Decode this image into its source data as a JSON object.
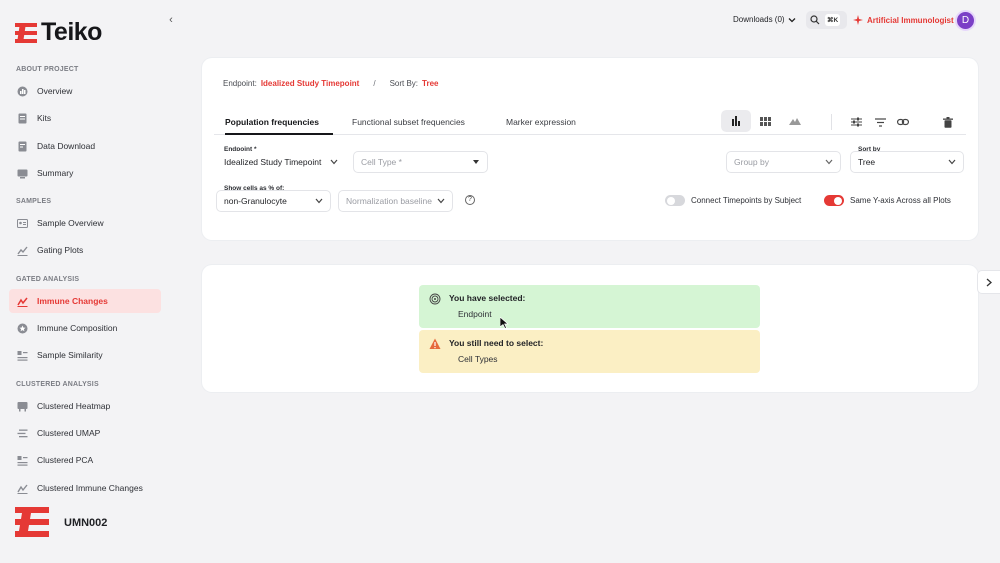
{
  "app": {
    "name": "Teiko",
    "project_code": "UMN002",
    "accent": "#e53935"
  },
  "sidebar": {
    "sections": [
      {
        "label": "ABOUT PROJECT"
      },
      {
        "label": "SAMPLES"
      },
      {
        "label": "GATED ANALYSIS"
      },
      {
        "label": "CLUSTERED ANALYSIS"
      }
    ],
    "items": [
      {
        "label": "Overview",
        "icon": "bar-chart-icon"
      },
      {
        "label": "Kits",
        "icon": "document-icon"
      },
      {
        "label": "Data Download",
        "icon": "download-document-icon"
      },
      {
        "label": "Summary",
        "icon": "monitor-icon"
      },
      {
        "label": "Sample Overview",
        "icon": "id-card-icon"
      },
      {
        "label": "Gating Plots",
        "icon": "chart-icon"
      },
      {
        "label": "Immune Changes",
        "icon": "trend-icon",
        "active": true
      },
      {
        "label": "Immune Composition",
        "icon": "star-badge-icon"
      },
      {
        "label": "Sample Similarity",
        "icon": "list-icon"
      },
      {
        "label": "Clustered Heatmap",
        "icon": "heatmap-icon"
      },
      {
        "label": "Clustered UMAP",
        "icon": "lines-icon"
      },
      {
        "label": "Clustered PCA",
        "icon": "list-icon"
      },
      {
        "label": "Clustered Immune Changes",
        "icon": "trend-icon"
      }
    ]
  },
  "topbar": {
    "downloads": "Downloads (0)",
    "shortcut": "⌘K",
    "ai_label": "Artificial Immunologist",
    "avatar_initial": "D"
  },
  "breadcrumb": {
    "endpoint_key": "Endpoint:",
    "endpoint_value": "Idealized Study Timepoint",
    "separator": "/",
    "sort_key": "Sort By:",
    "sort_value": "Tree"
  },
  "tabs": [
    {
      "label": "Population frequencies",
      "active": true
    },
    {
      "label": "Functional subset frequencies"
    },
    {
      "label": "Marker expression"
    }
  ],
  "controls": {
    "endpoint_label": "Endpoint *",
    "endpoint_value": "Idealized Study Timepoint",
    "cell_type_placeholder": "Cell Type *",
    "group_by_placeholder": "Group by",
    "sort_by_label": "Sort by",
    "sort_by_value": "Tree",
    "show_cells_label": "Show cells as % of:",
    "show_cells_value": "non-Granulocyte",
    "normalization_placeholder": "Normalization baseline",
    "help": "?",
    "connect_timepoints_label": "Connect Timepoints by Subject",
    "connect_timepoints_on": false,
    "same_yaxis_label": "Same Y-axis Across all Plots",
    "same_yaxis_on": true
  },
  "status": {
    "selected_title": "You have selected:",
    "selected_item": "Endpoint",
    "needed_title": "You still need to select:",
    "needed_item": "Cell Types"
  }
}
